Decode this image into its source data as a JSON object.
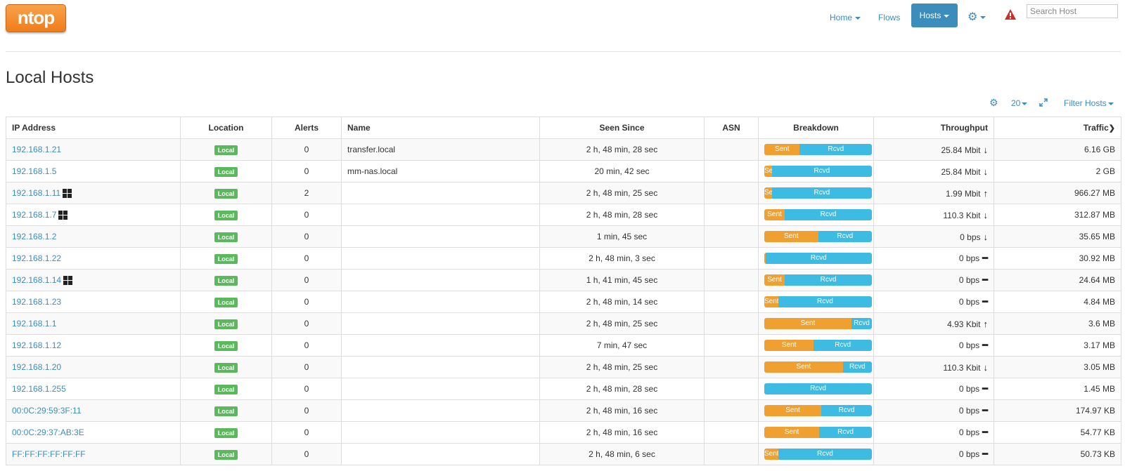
{
  "brand": {
    "logo_text": "ntop"
  },
  "nav": {
    "home": "Home",
    "flows": "Flows",
    "hosts": "Hosts",
    "search_placeholder": "Search Host"
  },
  "page": {
    "title": "Local Hosts"
  },
  "table_tools": {
    "per_page": "20",
    "filter": "Filter Hosts"
  },
  "table": {
    "columns": [
      "IP Address",
      "Location",
      "Alerts",
      "Name",
      "Seen Since",
      "ASN",
      "Breakdown",
      "Throughput",
      "Traffic"
    ],
    "sorted_column": "Traffic",
    "rows": [
      {
        "ip": "192.168.1.21",
        "windows": false,
        "location": "Local",
        "alerts": "0",
        "name": "transfer.local",
        "seen": "2 h, 48 min, 28 sec",
        "asn": "",
        "sent_pct": 0.33,
        "throughput": "25.84 Mbit",
        "trend": "down",
        "traffic": "6.16 GB"
      },
      {
        "ip": "192.168.1.5",
        "windows": false,
        "location": "Local",
        "alerts": "0",
        "name": "mm-nas.local",
        "seen": "20 min, 42 sec",
        "asn": "",
        "sent_pct": 0.07,
        "throughput": "25.84 Mbit",
        "trend": "down",
        "traffic": "2 GB"
      },
      {
        "ip": "192.168.1.11",
        "windows": true,
        "location": "Local",
        "alerts": "2",
        "name": "",
        "seen": "2 h, 48 min, 25 sec",
        "asn": "",
        "sent_pct": 0.07,
        "throughput": "1.99 Mbit",
        "trend": "up",
        "traffic": "966.27 MB"
      },
      {
        "ip": "192.168.1.7",
        "windows": true,
        "location": "Local",
        "alerts": "0",
        "name": "",
        "seen": "2 h, 48 min, 28 sec",
        "asn": "",
        "sent_pct": 0.19,
        "throughput": "110.3 Kbit",
        "trend": "down",
        "traffic": "312.87 MB"
      },
      {
        "ip": "192.168.1.2",
        "windows": false,
        "location": "Local",
        "alerts": "0",
        "name": "",
        "seen": "1 min, 45 sec",
        "asn": "",
        "sent_pct": 0.5,
        "throughput": "0 bps",
        "trend": "down",
        "traffic": "35.65 MB"
      },
      {
        "ip": "192.168.1.22",
        "windows": false,
        "location": "Local",
        "alerts": "0",
        "name": "",
        "seen": "2 h, 48 min, 3 sec",
        "asn": "",
        "sent_pct": 0.01,
        "throughput": "0 bps",
        "trend": "flat",
        "traffic": "30.92 MB"
      },
      {
        "ip": "192.168.1.14",
        "windows": true,
        "location": "Local",
        "alerts": "0",
        "name": "",
        "seen": "1 h, 41 min, 45 sec",
        "asn": "",
        "sent_pct": 0.19,
        "throughput": "0 bps",
        "trend": "flat",
        "traffic": "24.64 MB"
      },
      {
        "ip": "192.168.1.23",
        "windows": false,
        "location": "Local",
        "alerts": "0",
        "name": "",
        "seen": "2 h, 48 min, 14 sec",
        "asn": "",
        "sent_pct": 0.13,
        "throughput": "0 bps",
        "trend": "flat",
        "traffic": "4.84 MB"
      },
      {
        "ip": "192.168.1.1",
        "windows": false,
        "location": "Local",
        "alerts": "0",
        "name": "",
        "seen": "2 h, 48 min, 25 sec",
        "asn": "",
        "sent_pct": 0.81,
        "throughput": "4.93 Kbit",
        "trend": "up",
        "traffic": "3.6 MB"
      },
      {
        "ip": "192.168.1.12",
        "windows": false,
        "location": "Local",
        "alerts": "0",
        "name": "",
        "seen": "7 min, 47 sec",
        "asn": "",
        "sent_pct": 0.46,
        "throughput": "0 bps",
        "trend": "flat",
        "traffic": "3.17 MB"
      },
      {
        "ip": "192.168.1.20",
        "windows": false,
        "location": "Local",
        "alerts": "0",
        "name": "",
        "seen": "2 h, 48 min, 25 sec",
        "asn": "",
        "sent_pct": 0.73,
        "throughput": "110.3 Kbit",
        "trend": "down",
        "traffic": "3.05 MB"
      },
      {
        "ip": "192.168.1.255",
        "windows": false,
        "location": "Local",
        "alerts": "0",
        "name": "",
        "seen": "2 h, 48 min, 28 sec",
        "asn": "",
        "sent_pct": 0.0,
        "throughput": "0 bps",
        "trend": "flat",
        "traffic": "1.45 MB"
      },
      {
        "ip": "00:0C:29:59:3F:11",
        "windows": false,
        "location": "Local",
        "alerts": "0",
        "name": "",
        "seen": "2 h, 48 min, 16 sec",
        "asn": "",
        "sent_pct": 0.53,
        "throughput": "0 bps",
        "trend": "flat",
        "traffic": "174.97 KB"
      },
      {
        "ip": "00:0C:29:37:AB:3E",
        "windows": false,
        "location": "Local",
        "alerts": "0",
        "name": "",
        "seen": "2 h, 48 min, 16 sec",
        "asn": "",
        "sent_pct": 0.51,
        "throughput": "0 bps",
        "trend": "flat",
        "traffic": "54.77 KB"
      },
      {
        "ip": "FF:FF:FF:FF:FF:FF",
        "windows": false,
        "location": "Local",
        "alerts": "0",
        "name": "",
        "seen": "2 h, 48 min, 6 sec",
        "asn": "",
        "sent_pct": 0.13,
        "throughput": "0 bps",
        "trend": "flat",
        "traffic": "50.73 KB"
      }
    ],
    "breakdown_labels": {
      "sent": "Sent",
      "rcvd": "Rcvd"
    }
  },
  "colors": {
    "accent": "#3c8dbc",
    "sent": "#f0a030",
    "rcvd": "#3dbbe3",
    "local_badge": "#5cb85c",
    "alert_icon": "#c9302c",
    "logo": "#ef7d1a"
  }
}
